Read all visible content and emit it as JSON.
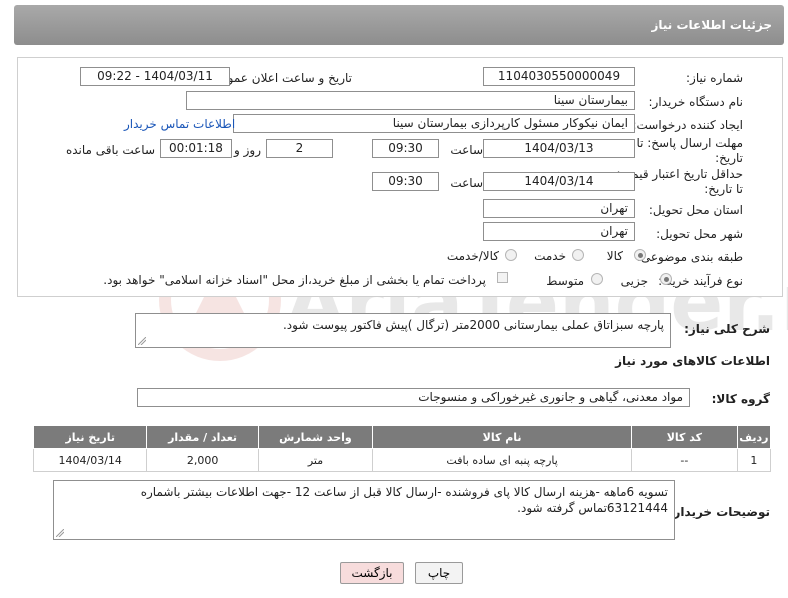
{
  "header": {
    "title": "جزئیات اطلاعات نیاز"
  },
  "fields": {
    "need_number_label": "شماره نیاز:",
    "need_number": "1104030550000049",
    "announce_label": "تاریخ و ساعت اعلان عمومی:",
    "announce_value": "1404/03/11 - 09:22",
    "buyer_org_label": "نام دستگاه خریدار:",
    "buyer_org": "بیمارستان سینا",
    "requester_label": "ایجاد کننده درخواست:",
    "requester": "ایمان نیکوکار مسئول کارپردازی  بیمارستان سینا",
    "contact_link": "اطلاعات تماس خریدار",
    "reply_deadline_label_1": "مهلت ارسال پاسخ: تا",
    "reply_deadline_label_2": "تاریخ:",
    "reply_date": "1404/03/13",
    "time_label": "ساعت",
    "reply_time": "09:30",
    "days_value": "2",
    "days_label": "روز و",
    "remaining_time": "00:01:18",
    "remaining_label": "ساعت باقی مانده",
    "price_valid_label_1": "حداقل تاریخ اعتبار قیمت:",
    "price_valid_label_2": "تا تاریخ:",
    "price_valid_date": "1404/03/14",
    "price_valid_time": "09:30",
    "province_label": "استان محل تحویل:",
    "province": "تهران",
    "city_label": "شهر محل تحویل:",
    "city": "تهران",
    "category_label": "طبقه بندی موضوعی:",
    "category_options": [
      "کالا",
      "خدمت",
      "کالا/خدمت"
    ],
    "purchase_type_label": "نوع فرآیند خرید :",
    "purchase_options": [
      "جزیی",
      "متوسط"
    ],
    "payment_note": "پرداخت تمام یا بخشی از مبلغ خرید،از محل \"اسناد خزانه اسلامی\" خواهد بود."
  },
  "description": {
    "label": "شرح کلی نیاز:",
    "text": "پارچه سبزاتاق عملی بیمارستانی 2000متر (ترگال )پیش فاکتور پیوست شود."
  },
  "goods": {
    "section_title": "اطلاعات کالاهای مورد نیاز",
    "group_label": "گروه کالا:",
    "group_value": "مواد معدنی، گیاهی و جانوری غیرخوراکی و منسوجات",
    "columns": [
      "ردیف",
      "کد کالا",
      "نام کالا",
      "واحد شمارش",
      "تعداد / مقدار",
      "تاریخ نیاز"
    ],
    "rows": [
      [
        "1",
        "--",
        "پارچه پنبه ای ساده بافت",
        "متر",
        "2,000",
        "1404/03/14"
      ]
    ]
  },
  "buyer_notes": {
    "label": "توضیحات خریدار:",
    "text": "تسویه 6ماهه -هزینه ارسال کالا پای فروشنده -ارسال کالا قبل از ساعت 12 -جهت اطلاعات بیشتر باشماره 63121444تماس گرفته شود."
  },
  "buttons": {
    "print": "چاپ",
    "back": "بازگشت"
  },
  "watermark": {
    "text": "AriaTender.neT"
  },
  "colors": {
    "header_bg": "#999999",
    "table_header_bg": "#7b7b7b",
    "link": "#1a56b8",
    "back_button_bg": "#f7dcdc"
  }
}
